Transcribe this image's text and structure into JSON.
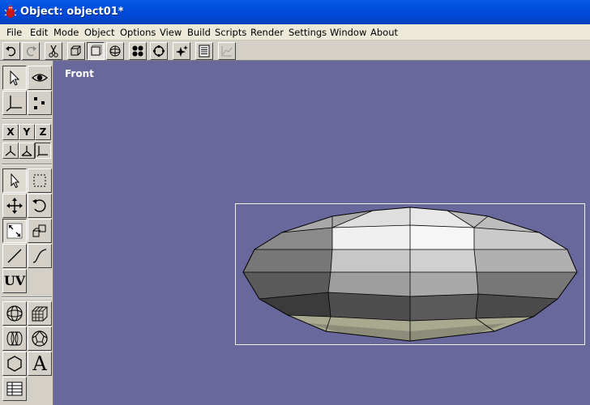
{
  "window": {
    "title": "Object: object01*"
  },
  "menu": [
    "File",
    "Edit",
    "Mode",
    "Object",
    "Options",
    "View",
    "Build",
    "Scripts",
    "Render",
    "Settings",
    "Window",
    "About"
  ],
  "toolbar": {
    "buttons": [
      {
        "icon": "undo-icon"
      },
      {
        "icon": "redo-icon"
      },
      {
        "icon": "cut-icon"
      },
      {
        "icon": "view-3d-icon"
      },
      {
        "icon": "view-front-icon"
      },
      {
        "icon": "view-sphere-icon"
      },
      {
        "icon": "points-icon"
      },
      {
        "icon": "rotate-view-icon"
      },
      {
        "icon": "sparkle-icon"
      },
      {
        "icon": "list-icon"
      },
      {
        "icon": "graph-icon"
      }
    ]
  },
  "axes": {
    "x": "X",
    "y": "Y",
    "z": "Z"
  },
  "tools": {
    "uv_label": "UV",
    "text_label": "A"
  },
  "viewport": {
    "label": "Front",
    "background": "#69689c"
  },
  "colors": {
    "titlebar": "#0050e0",
    "menubar": "#ece9d8",
    "chrome": "#d4d0c8"
  }
}
